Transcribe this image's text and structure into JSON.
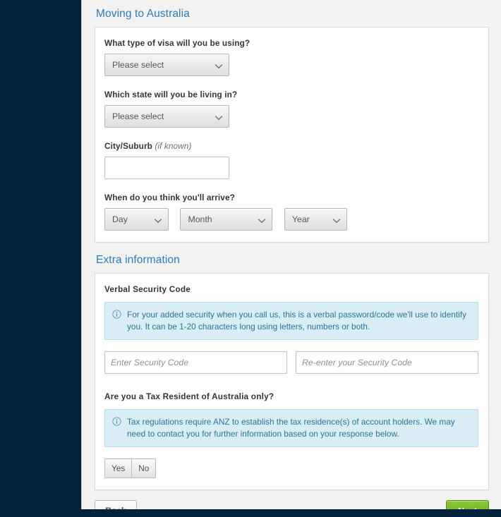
{
  "sections": [
    {
      "heading": "Moving to Australia",
      "fields": [
        {
          "label": "What type of visa will you be using?",
          "value": "Please select"
        },
        {
          "label": "Which state will you be living in?",
          "value": "Please select"
        },
        {
          "label": "City/Suburb",
          "hint": "(if known)",
          "value": ""
        },
        {
          "label": "When do you think you'll arrive?"
        }
      ],
      "date": {
        "day": "Day",
        "month": "Month",
        "year": "Year"
      }
    },
    {
      "heading": "Extra information",
      "security": {
        "title": "Verbal Security Code",
        "info": "For your added security when you call us, this is a verbal password/code we'll use to identify you. It can be 1-20 characters long using letters, numbers or both.",
        "code_placeholder": "Enter Security Code",
        "code_value": "",
        "confirm_placeholder": "Re-enter your Security Code",
        "confirm_value": ""
      },
      "tax": {
        "title": "Are you a Tax Resident of Australia only?",
        "info": "Tax regulations require ANZ to establish the tax residence(s) of account holders. We may need to contact you for further information based on your response below.",
        "options": [
          "Yes",
          "No"
        ]
      }
    }
  ],
  "nav": {
    "back_label": "Back",
    "next_label": "Next"
  },
  "colors": {
    "heading_blue": "#2d7cb5",
    "info_bg": "#d8edf5",
    "info_border": "#b8dcea",
    "info_text": "#2d7396",
    "next_green": "#7ab928",
    "rail_navy": "#05223c"
  }
}
